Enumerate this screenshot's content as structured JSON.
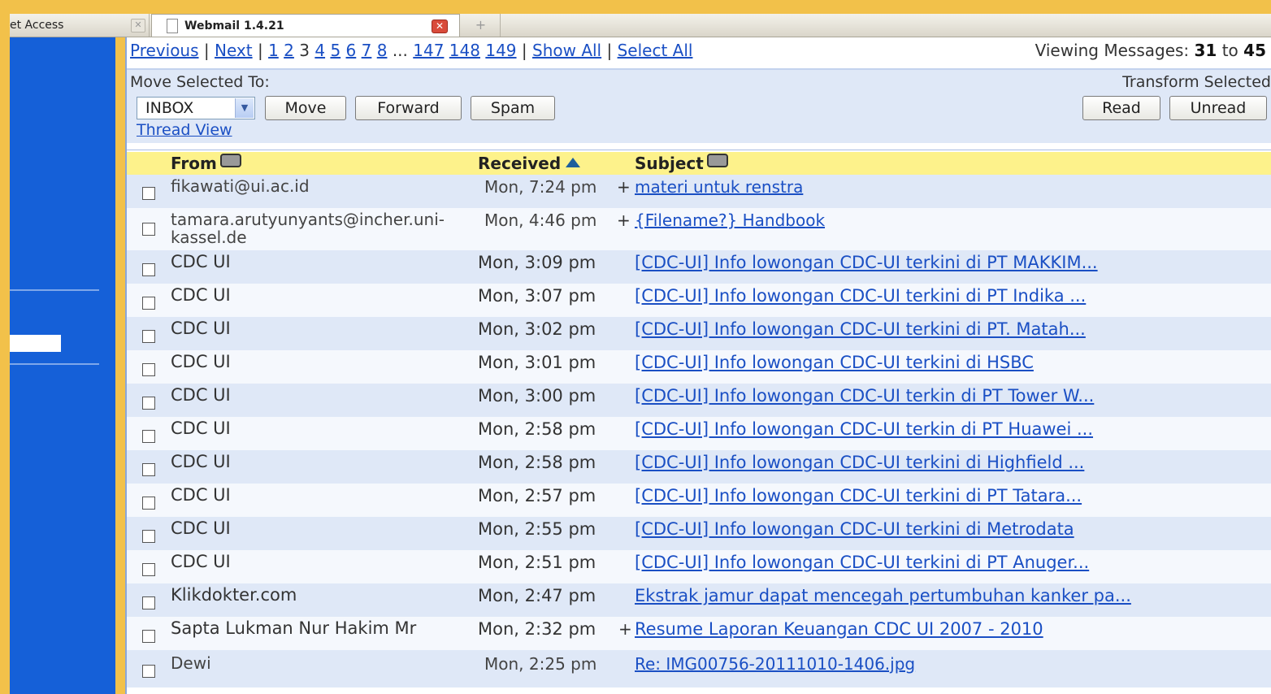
{
  "browser": {
    "tabs": [
      {
        "label": "et Access",
        "active": false
      },
      {
        "label": "Webmail 1.4.21",
        "active": true
      }
    ],
    "new_tab_glyph": "+"
  },
  "pager": {
    "previous": "Previous",
    "next": "Next",
    "pages": [
      "1",
      "2",
      "3",
      "4",
      "5",
      "6",
      "7",
      "8"
    ],
    "current_page": "3",
    "ellipsis": "...",
    "last_pages": [
      "147",
      "148",
      "149"
    ],
    "show_all": "Show All",
    "select_all": "Select All",
    "viewing_label": "Viewing Messages:",
    "viewing_from": "31",
    "viewing_to_word": "to",
    "viewing_to": "45"
  },
  "toolbar": {
    "move_label": "Move Selected To:",
    "folder_selected": "INBOX",
    "move_button": "Move",
    "forward_button": "Forward",
    "spam_button": "Spam",
    "thread_view": "Thread View",
    "transform_label": "Transform Selected",
    "read_button": "Read",
    "unread_button": "Unread"
  },
  "table": {
    "headers": {
      "from": "From",
      "received": "Received",
      "subject": "Subject"
    },
    "rows": [
      {
        "from": "fikawati@ui.ac.id",
        "received": "Mon, 7:24 pm",
        "plus": "+",
        "subject": "materi untuk renstra",
        "bold": false
      },
      {
        "from": "tamara.arutyunyants@incher.uni-kassel.de",
        "received": "Mon, 4:46 pm",
        "plus": "+",
        "subject": "{Filename?} Handbook",
        "bold": false
      },
      {
        "from": "CDC UI",
        "received": "Mon, 3:09 pm",
        "plus": "",
        "subject": "[CDC-UI] Info lowongan CDC-UI terkini di PT MAKKIM...",
        "bold": true
      },
      {
        "from": "CDC UI",
        "received": "Mon, 3:07 pm",
        "plus": "",
        "subject": "[CDC-UI] Info lowongan CDC-UI terkini di PT Indika ...",
        "bold": true
      },
      {
        "from": "CDC UI",
        "received": "Mon, 3:02 pm",
        "plus": "",
        "subject": "[CDC-UI] Info lowongan CDC-UI terkini di PT. Matah...",
        "bold": true
      },
      {
        "from": "CDC UI",
        "received": "Mon, 3:01 pm",
        "plus": "",
        "subject": "[CDC-UI] Info lowongan CDC-UI terkini di HSBC",
        "bold": true
      },
      {
        "from": "CDC UI",
        "received": "Mon, 3:00 pm",
        "plus": "",
        "subject": "[CDC-UI] Info lowongan CDC-UI terkin di PT Tower W...",
        "bold": true
      },
      {
        "from": "CDC UI",
        "received": "Mon, 2:58 pm",
        "plus": "",
        "subject": "[CDC-UI] Info lowongan CDC-UI terkin di PT Huawei ...",
        "bold": true
      },
      {
        "from": "CDC UI",
        "received": "Mon, 2:58 pm",
        "plus": "",
        "subject": "[CDC-UI] Info lowongan CDC-UI terkini di Highfield ...",
        "bold": true
      },
      {
        "from": "CDC UI",
        "received": "Mon, 2:57 pm",
        "plus": "",
        "subject": "[CDC-UI] Info lowongan CDC-UI terkini di PT Tatara...",
        "bold": true
      },
      {
        "from": "CDC UI",
        "received": "Mon, 2:55 pm",
        "plus": "",
        "subject": "[CDC-UI] Info lowongan CDC-UI terkini di Metrodata",
        "bold": true
      },
      {
        "from": "CDC UI",
        "received": "Mon, 2:51 pm",
        "plus": "",
        "subject": "[CDC-UI] Info lowongan CDC-UI terkini di PT Anuger...",
        "bold": true
      },
      {
        "from": "Klikdokter.com",
        "received": "Mon, 2:47 pm",
        "plus": "",
        "subject": "Ekstrak jamur dapat mencegah pertumbuhan kanker pa...",
        "bold": true
      },
      {
        "from": "Sapta Lukman Nur Hakim Mr",
        "received": "Mon, 2:32 pm",
        "plus": "+",
        "subject": "Resume Laporan Keuangan CDC UI 2007 - 2010",
        "bold": true
      },
      {
        "from": "Dewi",
        "received": "Mon, 2:25 pm",
        "plus": "",
        "subject": "Re: IMG00756-20111010-1406.jpg",
        "bold": false
      }
    ]
  },
  "colors": {
    "frame": "#f2c14a",
    "left_panel": "#1560d8",
    "header_row": "#fdf28b",
    "row_even": "#dfe8f7",
    "link": "#1a4fc4"
  }
}
